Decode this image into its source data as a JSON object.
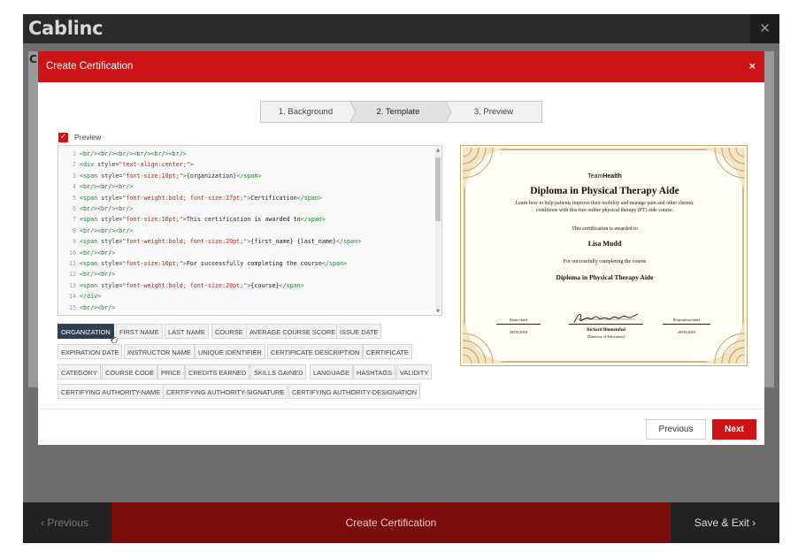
{
  "app": {
    "brand": "Cablinc",
    "close_glyph": "✕",
    "bg_letter": "C"
  },
  "footer": {
    "previous": "‹ Previous",
    "title": "Create Certification",
    "save_exit": "Save & Exit ›"
  },
  "modal": {
    "title": "Create Certification",
    "close_glyph": "×",
    "steps": [
      {
        "label": "1. Background"
      },
      {
        "label": "2. Template"
      },
      {
        "label": "3. Preview"
      }
    ],
    "active_step": 2,
    "preview_label": "Preview",
    "preview_checked": true,
    "buttons": {
      "previous": "Previous",
      "next": "Next"
    }
  },
  "editor": {
    "lines": [
      {
        "n": "1",
        "parts": [
          [
            "tag",
            "<br/><br/><br/><br/><br/><br/>"
          ]
        ]
      },
      {
        "n": "2",
        "parts": [
          [
            "tag",
            "<div "
          ],
          [
            "attr",
            "style="
          ],
          [
            "str",
            "\"text-align:center;\""
          ],
          [
            "tag",
            ">"
          ]
        ]
      },
      {
        "n": "3",
        "parts": [
          [
            "tag",
            "<span "
          ],
          [
            "attr",
            "style="
          ],
          [
            "str",
            "\"font-size:10pt;\""
          ],
          [
            "tag",
            ">"
          ],
          [
            "txt",
            "{organization}"
          ],
          [
            "tag",
            "</span>"
          ]
        ]
      },
      {
        "n": "4",
        "parts": [
          [
            "tag",
            "<br/><br/><br/>"
          ]
        ]
      },
      {
        "n": "5",
        "parts": [
          [
            "tag",
            "<span "
          ],
          [
            "attr",
            "style="
          ],
          [
            "str",
            "\"font-weight:bold; font-size:27pt;\""
          ],
          [
            "tag",
            ">"
          ],
          [
            "txt",
            "Certification"
          ],
          [
            "tag",
            "</span>"
          ]
        ]
      },
      {
        "n": "6",
        "parts": [
          [
            "tag",
            "<br/><br/><br/>"
          ]
        ]
      },
      {
        "n": "7",
        "parts": [
          [
            "tag",
            "<span "
          ],
          [
            "attr",
            "style="
          ],
          [
            "str",
            "\"font-size:16pt;\""
          ],
          [
            "tag",
            ">"
          ],
          [
            "txt",
            "This certification is awarded to"
          ],
          [
            "tag",
            "</span>"
          ]
        ]
      },
      {
        "n": "8",
        "parts": [
          [
            "tag",
            "<br/><br/><br/>"
          ]
        ]
      },
      {
        "n": "9",
        "parts": [
          [
            "tag",
            "<span "
          ],
          [
            "attr",
            "style="
          ],
          [
            "str",
            "\"font-weight:bold; font-size:20pt;\""
          ],
          [
            "tag",
            ">"
          ],
          [
            "txt",
            "{first_name} {last_name}"
          ],
          [
            "tag",
            "</span>"
          ]
        ]
      },
      {
        "n": "10",
        "parts": [
          [
            "tag",
            "<br/><br/>"
          ]
        ]
      },
      {
        "n": "11",
        "parts": [
          [
            "tag",
            "<span "
          ],
          [
            "attr",
            "style="
          ],
          [
            "str",
            "\"font-size:16pt;\""
          ],
          [
            "tag",
            ">"
          ],
          [
            "txt",
            "For successfully completing the course"
          ],
          [
            "tag",
            "</span>"
          ]
        ]
      },
      {
        "n": "12",
        "parts": [
          [
            "tag",
            "<br/><br/>"
          ]
        ]
      },
      {
        "n": "13",
        "parts": [
          [
            "tag",
            "<span "
          ],
          [
            "attr",
            "style="
          ],
          [
            "str",
            "\"font-weight:bold; font-size:20pt;\""
          ],
          [
            "tag",
            ">"
          ],
          [
            "txt",
            "{course}"
          ],
          [
            "tag",
            "</span>"
          ]
        ]
      },
      {
        "n": "14",
        "parts": [
          [
            "tag",
            "</div>"
          ]
        ]
      },
      {
        "n": "15",
        "parts": [
          [
            "tag",
            "<br/><br/>"
          ]
        ]
      }
    ]
  },
  "tags": [
    {
      "label": "ORGANIZATION",
      "active": true
    },
    {
      "label": "FIRST NAME"
    },
    {
      "label": "LAST NAME"
    },
    {
      "label": "COURSE"
    },
    {
      "label": "AVERAGE COURSE SCORE"
    },
    {
      "label": "ISSUE DATE"
    },
    {
      "label": "EXPIRATION DATE"
    },
    {
      "label": "INSTRUCTOR NAME"
    },
    {
      "label": "UNIQUE IDENTIFIER"
    },
    {
      "label": "CERTIFICATE DESCRIPTION"
    },
    {
      "label": "CERTIFICATE"
    },
    {
      "label": "CATEGORY"
    },
    {
      "label": "COURSE CODE"
    },
    {
      "label": "PRICE"
    },
    {
      "label": "CREDITS EARNED"
    },
    {
      "label": "SKILLS GAINED"
    },
    {
      "label": "LANGUAGE"
    },
    {
      "label": "HASHTAGS"
    },
    {
      "label": "VALIDITY"
    },
    {
      "label": "CERTIFYING AUTHORITY-NAME"
    },
    {
      "label": "CERTIFYING AUTHORITY-SIGNATURE"
    },
    {
      "label": "CERTIFYING AUTHORITY-DESIGNATION"
    }
  ],
  "certificate": {
    "org_prefix": "Team",
    "org_bold": "Health",
    "title": "Diploma in Physical Therapy Aide",
    "desc_line1": "Learn how to help patients improve their mobility and manage pain and other chronic",
    "desc_line2": "conditions with this free online physical therapy (PT) aide course.",
    "awarded": "This certification is awarded to",
    "name": "Lisa Mudd",
    "success": "For successfully completing the course",
    "course": "Diploma in Physical Therapy Aide",
    "issue_label": "[Issue date]",
    "issue_date": "29/05/2018",
    "signer": "Richard Blumenthal",
    "signer_title": "[Director of Education]",
    "expiry_label": "[Expiration date]",
    "expiry_date": "29/05/2019"
  },
  "colors": {
    "accent": "#cc1416",
    "footer_bar": "#7a0c0c",
    "gold": "#d9b57a"
  }
}
